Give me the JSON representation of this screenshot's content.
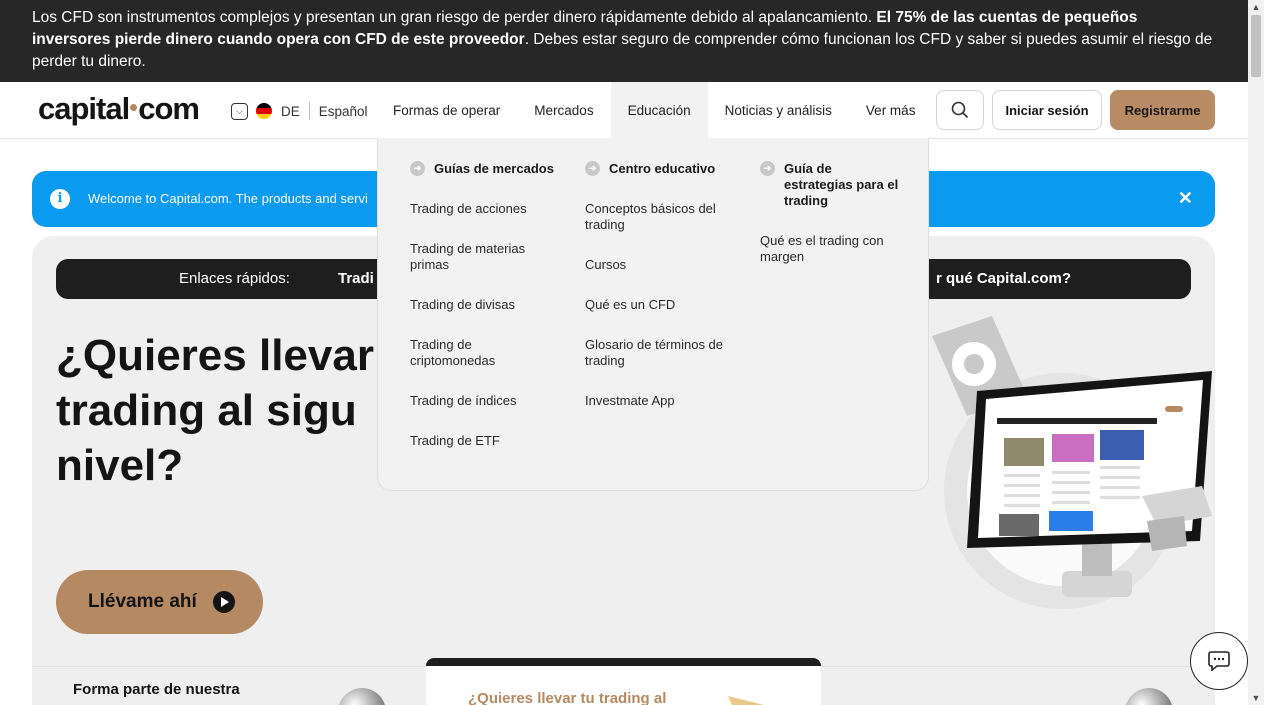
{
  "risk_banner": {
    "text_part1": "Los CFD son instrumentos complejos y presentan un gran riesgo de perder dinero rápidamente debido al apalancamiento. ",
    "text_bold": "El 75% de las cuentas de pequeños inversores pierde dinero cuando opera con CFD de este proveedor",
    "text_part2": ". Debes estar seguro de comprender cómo funcionan los CFD y saber si puedes asumir el riesgo de perder tu dinero."
  },
  "header": {
    "logo_left": "capital",
    "logo_right": "com",
    "country_code": "DE",
    "language": "Español",
    "nav": [
      "Formas de operar",
      "Mercados",
      "Educación",
      "Noticias y análisis",
      "Ver más"
    ],
    "login_label": "Iniciar sesión",
    "register_label": "Registrarme"
  },
  "welcome": {
    "message": "Welcome to Capital.com. The products and servi"
  },
  "quick_links": {
    "label": "Enlaces rápidos:",
    "first": "Tradi",
    "last": "r qué Capital.com?"
  },
  "hero": {
    "line1": "¿Quieres llevar",
    "line2": "trading al sigu",
    "line3": "nivel?",
    "cta_label": "Llévame ahí",
    "join_text": "Forma parte de nuestra",
    "card_title": "¿Quieres llevar tu trading al"
  },
  "dropdown": {
    "columns": [
      {
        "title": "Guías de mercados",
        "links": [
          "Trading de acciones",
          "Trading de materias primas",
          "Trading de divisas",
          "Trading de criptomonedas",
          "Trading de índices",
          "Trading de ETF"
        ]
      },
      {
        "title": "Centro educativo",
        "links": [
          "Conceptos básicos del trading",
          "Cursos",
          "Qué es un CFD",
          "Glosario de términos de trading",
          "Investmate App"
        ]
      },
      {
        "title": "Guía de estrategias para el trading",
        "links": [
          "Qué es el trading con margen"
        ]
      }
    ]
  },
  "colors": {
    "brand": "#b58a62",
    "banner_bg": "#272727",
    "welcome_bg": "#0a9aef"
  }
}
